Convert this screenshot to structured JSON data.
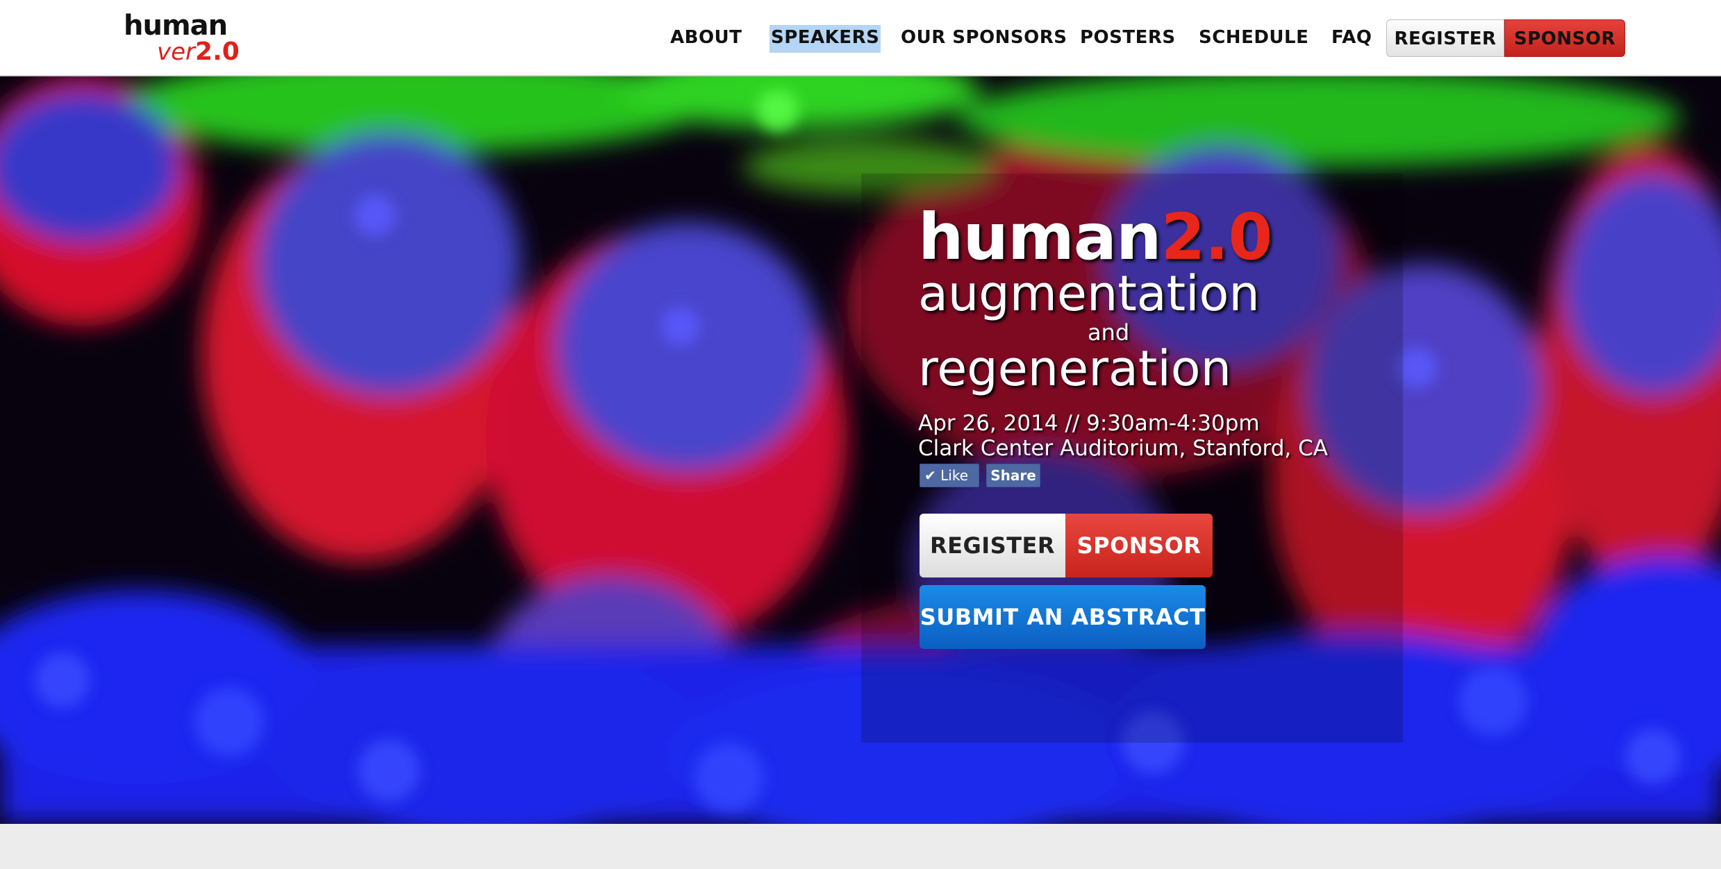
{
  "header": {
    "logo": {
      "top": "human",
      "ver": "ver",
      "num": "2.0"
    },
    "nav": {
      "about": "ABOUT",
      "speakers": "SPEAKERS",
      "sponsors": "OUR SPONSORS",
      "posters": "POSTERS",
      "schedule": "SCHEDULE",
      "faq": "FAQ"
    },
    "register_label": "REGISTER",
    "sponsor_label": "SPONSOR"
  },
  "hero": {
    "title_main": "human",
    "title_accent": "2.0",
    "line1": "augmentation",
    "and": "and",
    "line2": "regeneration",
    "date": "Apr 26, 2014 // 9:30am-4:30pm",
    "venue": "Clark Center Auditorium, Stanford, CA",
    "fb_like": "Like",
    "fb_share": "Share",
    "register_label": "REGISTER",
    "sponsor_label": "SPONSOR",
    "abstract_label": "SUBMIT AN ABSTRACT"
  },
  "colors": {
    "accent_red": "#e0201a",
    "register_gray": "#e3e3e3",
    "abstract_blue": "#0b5fc2",
    "facebook_blue": "#4e69a2",
    "nav_highlight": "#b4d5f5"
  },
  "icons": {
    "fb_like": "checkmark-icon"
  }
}
